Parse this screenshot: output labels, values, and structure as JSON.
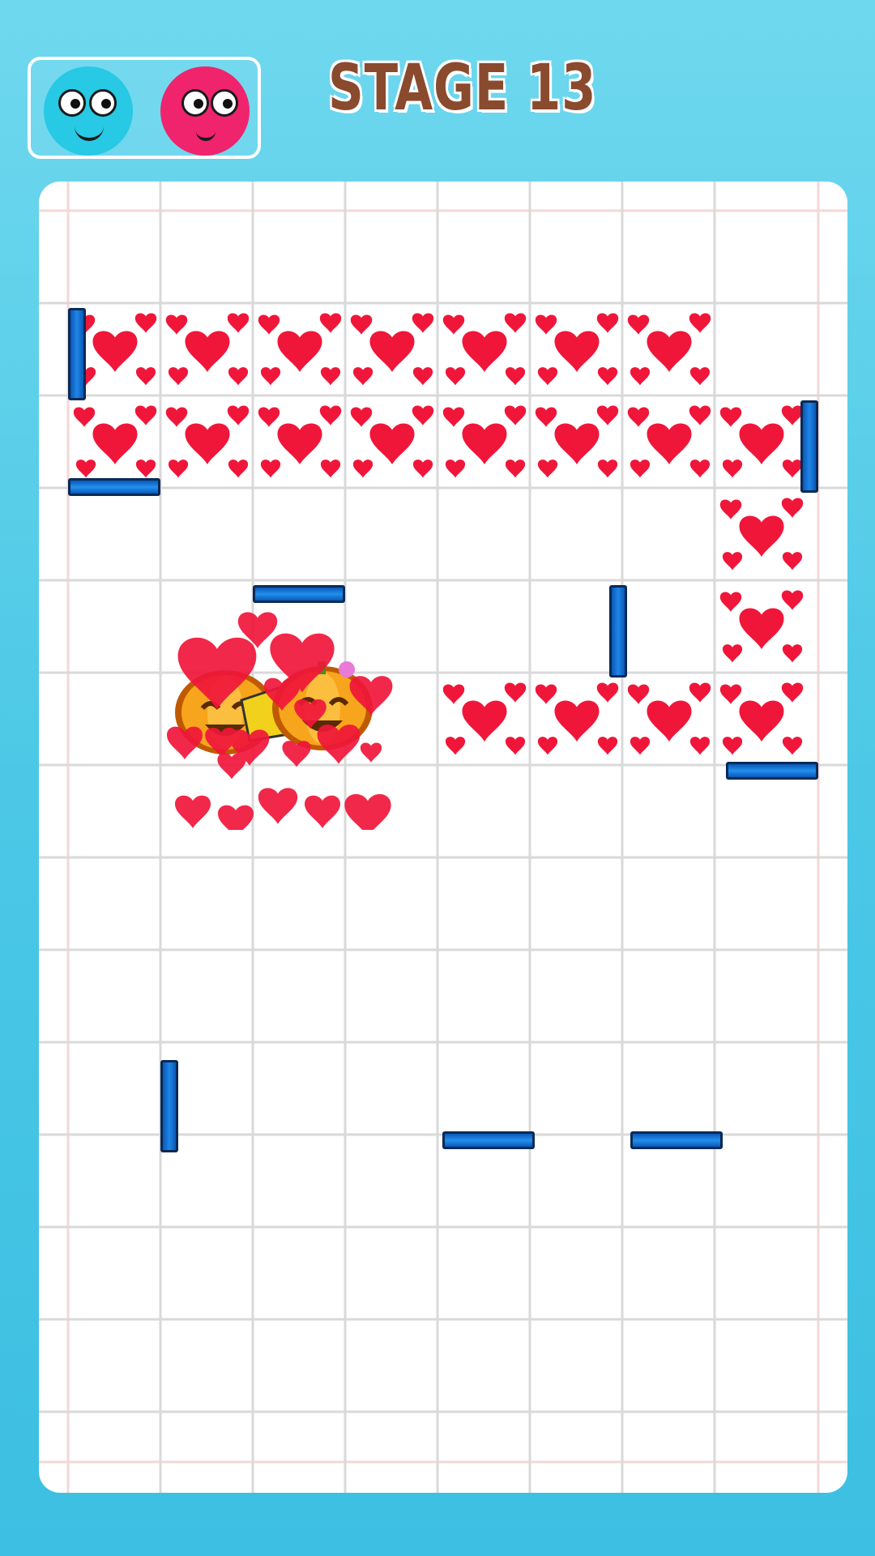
{
  "header": {
    "stage_label": "STAGE 13",
    "characters": [
      {
        "name": "cyan-ball",
        "color": "#27c9e4"
      },
      {
        "name": "pink-ball",
        "color": "#f0236d"
      }
    ]
  },
  "colors": {
    "background": "#4cc8e6",
    "heart": "#f0163a",
    "wall": "#1f86e6",
    "pumpkin": "#f7a51c"
  },
  "board": {
    "columns": 8,
    "rows": 13,
    "heart_tiles": [
      [
        0,
        1
      ],
      [
        1,
        1
      ],
      [
        2,
        1
      ],
      [
        3,
        1
      ],
      [
        4,
        1
      ],
      [
        5,
        1
      ],
      [
        6,
        1
      ],
      [
        0,
        2
      ],
      [
        1,
        2
      ],
      [
        2,
        2
      ],
      [
        3,
        2
      ],
      [
        4,
        2
      ],
      [
        5,
        2
      ],
      [
        6,
        2
      ],
      [
        7,
        2
      ],
      [
        7,
        3
      ],
      [
        7,
        4
      ],
      [
        4,
        5
      ],
      [
        5,
        5
      ],
      [
        6,
        5
      ],
      [
        7,
        5
      ]
    ],
    "pieces_icon": "pumpkin-pair-icon"
  }
}
